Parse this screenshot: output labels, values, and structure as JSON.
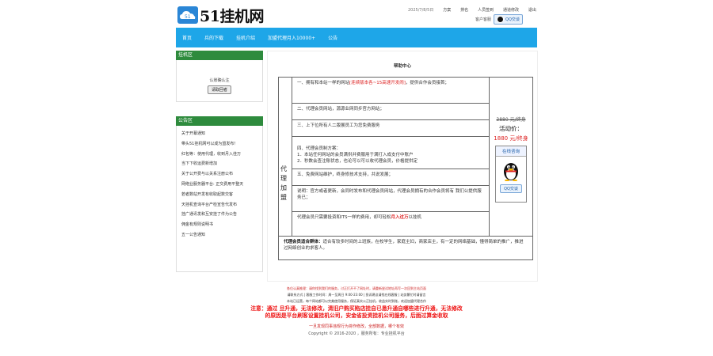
{
  "header": {
    "logo_text": "51挂机网",
    "date": "2025/7/8/5日",
    "links": [
      "方案",
      "排名",
      "人员签到",
      "通道修改",
      "退出"
    ],
    "qq_label": "客户客服",
    "qq_button": "QQ交谈"
  },
  "nav": {
    "items": [
      "首页",
      "兵的下载",
      "挂机介绍",
      "加盟代理月入10000+",
      "公告"
    ]
  },
  "sidebar": {
    "login_header": "挂机区",
    "login_text": "认账确认注",
    "login_button": "请取回者",
    "notice_header": "公告区",
    "notices": [
      "关于开幕通知",
      "带头51挂机网可以成为盟发布！",
      "红包等：使用代理，收到月入佳万",
      "当下下收运费新增加",
      "关于公开费与以关系注册公布",
      "网络业服务器平台: 正交费用平整天",
      "若者数站开发有收取起数交客",
      "天挂机查询平台产检宣告代发布",
      "挂广通讯发和互安挂了件为公告",
      "佣金有规则说明书",
      "五一公告通知"
    ]
  },
  "main": {
    "title": "帮助中心",
    "vertical_label": "代理加盟",
    "items": [
      {
        "before": "一、拥有和本站一样的网站",
        "red": "[连续版本各~15高速开发闹]",
        "after": "，提供合作会员接首；"
      },
      {
        "before": "二、代理会员网站，源源业网同步官方网站；",
        "red": "",
        "after": ""
      },
      {
        "before": "三、上下位所有人二版展员工为您免费服务",
        "red": "",
        "after": ""
      },
      {
        "before": "四、代理会员制方案：\n1．本站任何网站的会员满供并费服用于满打入成支付中账户\n2．秒数会查注账状态，也论可以可以收代理会员，价格提供定",
        "red": "",
        "after": ""
      },
      {
        "before": "五、免费网站维护，终身修技术支持，共说发展；",
        "red": "",
        "after": ""
      },
      {
        "before": "说明：官方或者更新，会同时发布和代理会员网站，代理会员拥有的合作会员将有 我们公提供服务已；",
        "red": "",
        "after": ""
      },
      {
        "before": "代理会员只需要投资和ITS一样的费用，却可轻松",
        "red": "月入过万",
        "after": "以挂机"
      }
    ],
    "price": {
      "old": "3880 元/终身",
      "label": "活动价：",
      "new": "1880 元/终身",
      "card_title": "在线咨询",
      "card_button": "QQ交谈"
    },
    "suit_label": "代理会员适合群体：",
    "suit_text": "适合有较多时间的上班族，在校学生，家庭主妇，商家店主，有一定的网络基础，懂得简单的推广，推进过网络创业的求客人。"
  },
  "footer": {
    "line1": "各位认真推理：请你找到我们的服务，讨正打开不了网址时，请重新尝试地址再写一次回到主站页面",
    "line2": "请联系方式 | 客服工作时间：周一至周日 9:00-23:00 | 投诉建议请找在线客服 | 站务繁忙时请留言",
    "line3": "本站已运营，每个网站都可以完美使用服务，保证真实公正挂机，收益实时到账，欢迎加盟代理合作",
    "warning1": "注意：通过   旦升通，无法修改，清旧户购买陷店挂自已恳升通自哪些进行升通，无法修改",
    "warning2": "的原因是平台刷客设置挂机公司，安金省投资挂机公司服务，后面过算金收取",
    "link_line": "一旦发现同事违规行为将作修改，全部数据，哪个有效",
    "copyright": "Copyright © 2016-2020 ，服务所有：专业挂机平台"
  },
  "colors": {
    "nav": "#1ea6e8",
    "side_header": "#2e8b3d",
    "accent_red": "#dd2222"
  }
}
